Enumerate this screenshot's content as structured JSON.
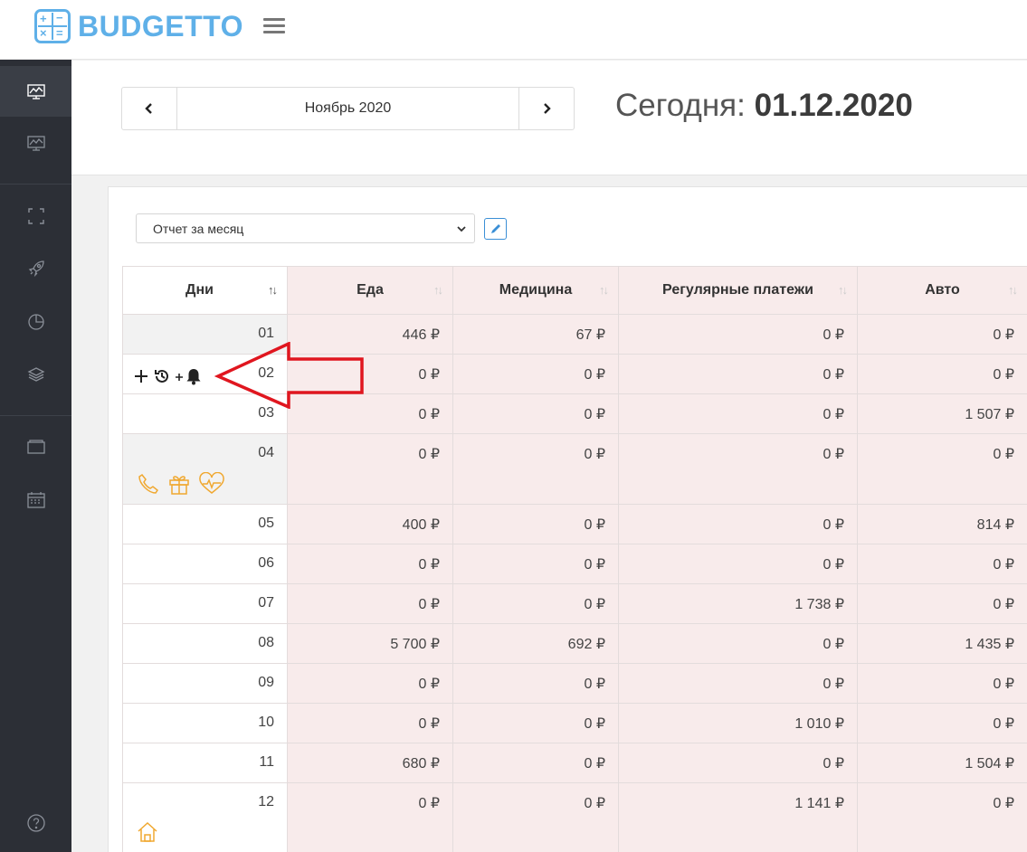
{
  "app": {
    "name": "BUDGETTO"
  },
  "colors": {
    "brand": "#5fb0e8",
    "sidebar": "#2c2f36",
    "cell_pink": "#f8ebeb",
    "annotation_red": "#e0161f",
    "icon_orange": "#f0a830"
  },
  "nav": {
    "prev_icon": "chevron-left-icon",
    "month": "Ноябрь 2020",
    "next_icon": "chevron-right-icon"
  },
  "today": {
    "label": "Сегодня:",
    "date": "01.12.2020"
  },
  "report": {
    "selected": "Отчет за месяц"
  },
  "table": {
    "columns": [
      "Дни",
      "Еда",
      "Медицина",
      "Регулярные платежи",
      "Авто"
    ],
    "rows": [
      {
        "day": "01",
        "values": [
          "446 ₽",
          "67 ₽",
          "0 ₽",
          "0 ₽"
        ]
      },
      {
        "day": "02",
        "values": [
          "0 ₽",
          "0 ₽",
          "0 ₽",
          "0 ₽"
        ]
      },
      {
        "day": "03",
        "values": [
          "0 ₽",
          "0 ₽",
          "0 ₽",
          "1 507 ₽"
        ]
      },
      {
        "day": "04",
        "values": [
          "0 ₽",
          "0 ₽",
          "0 ₽",
          "0 ₽"
        ]
      },
      {
        "day": "05",
        "values": [
          "400 ₽",
          "0 ₽",
          "0 ₽",
          "814 ₽"
        ]
      },
      {
        "day": "06",
        "values": [
          "0 ₽",
          "0 ₽",
          "0 ₽",
          "0 ₽"
        ]
      },
      {
        "day": "07",
        "values": [
          "0 ₽",
          "0 ₽",
          "1 738 ₽",
          "0 ₽"
        ]
      },
      {
        "day": "08",
        "values": [
          "5 700 ₽",
          "692 ₽",
          "0 ₽",
          "1 435 ₽"
        ]
      },
      {
        "day": "09",
        "values": [
          "0 ₽",
          "0 ₽",
          "0 ₽",
          "0 ₽"
        ]
      },
      {
        "day": "10",
        "values": [
          "0 ₽",
          "0 ₽",
          "1 010 ₽",
          "0 ₽"
        ]
      },
      {
        "day": "11",
        "values": [
          "680 ₽",
          "0 ₽",
          "0 ₽",
          "1 504 ₽"
        ]
      },
      {
        "day": "12",
        "values": [
          "0 ₽",
          "0 ₽",
          "1 141 ₽",
          "0 ₽"
        ]
      }
    ]
  },
  "row_icons": {
    "02": [
      "plus-icon",
      "history-icon",
      "add-reminder-icon"
    ],
    "04": [
      "phone-icon",
      "gift-icon",
      "heart-pulse-icon"
    ],
    "12": [
      "home-icon"
    ]
  },
  "sidebar": [
    "dashboard-icon",
    "report-icon",
    "fullscreen-icon",
    "rocket-icon",
    "pie-chart-icon",
    "layers-icon",
    "wallet-icon",
    "calendar-icon",
    "help-icon"
  ]
}
